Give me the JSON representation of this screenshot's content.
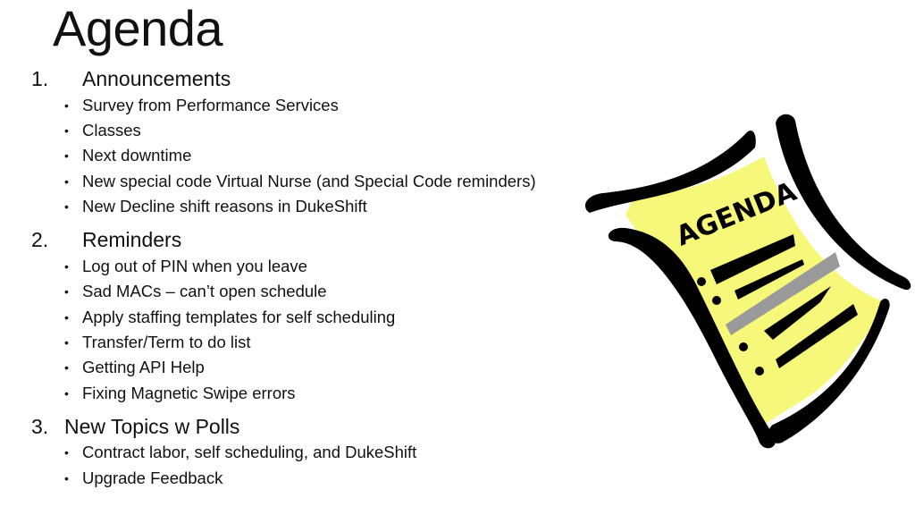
{
  "slide": {
    "title": "Agenda",
    "sections": [
      {
        "number": "1.",
        "heading": "Announcements",
        "items": [
          "Survey from Performance Services",
          "Classes",
          "Next downtime",
          "New special code Virtual Nurse (and Special Code reminders)",
          "New Decline shift reasons in DukeShift"
        ]
      },
      {
        "number": "2.",
        "heading": "Reminders",
        "items": [
          "Log out of PIN when you leave",
          "Sad MACs – can’t open schedule",
          "Apply staffing templates for self scheduling",
          "Transfer/Term to do list",
          "Getting API Help",
          "Fixing Magnetic Swipe errors"
        ]
      },
      {
        "number": "3.",
        "heading": "New Topics w Polls",
        "items": [
          "Contract labor, self scheduling, and DukeShift",
          "Upgrade Feedback"
        ]
      }
    ],
    "bullet_glyph": "•",
    "clipart": {
      "icon": "agenda-paper-icon",
      "label": "AGENDA",
      "colors": {
        "paper": "#f7f77a",
        "ink": "#000000",
        "highlight": "#9a9a9a"
      }
    }
  }
}
